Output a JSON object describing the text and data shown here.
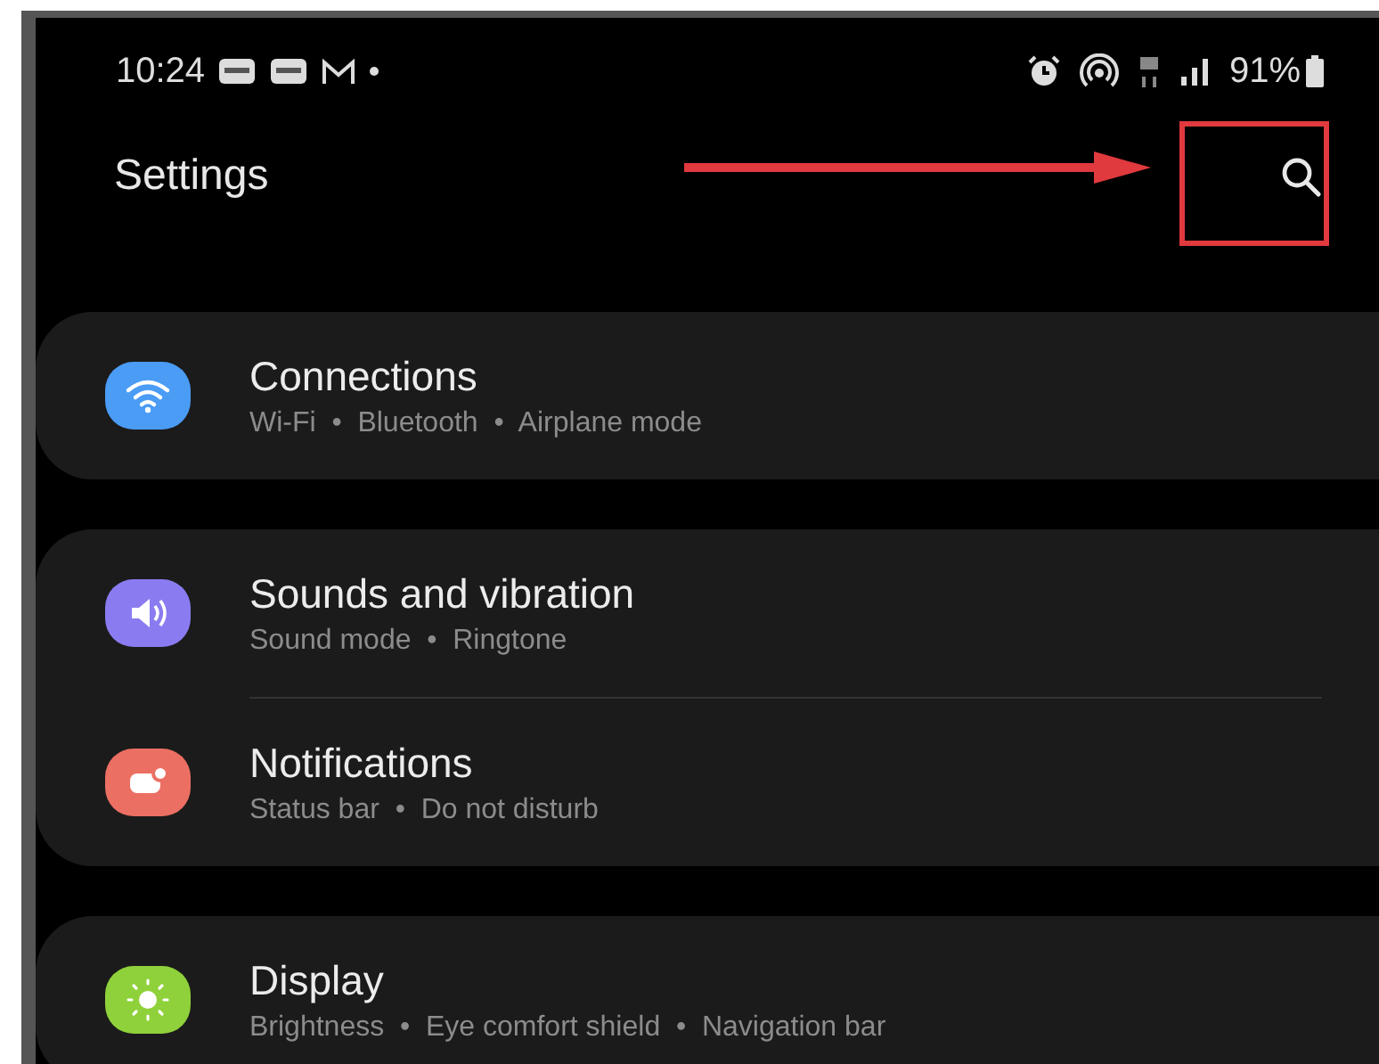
{
  "status_bar": {
    "time": "10:24",
    "battery": "91%"
  },
  "header": {
    "title": "Settings"
  },
  "groups": [
    {
      "items": [
        {
          "kind": "wifi",
          "color": "#4a9cf5",
          "title": "Connections",
          "subtitle": "Wi-Fi  •  Bluetooth  •  Airplane mode"
        }
      ]
    },
    {
      "items": [
        {
          "kind": "sound",
          "color": "#8a7cf0",
          "title": "Sounds and vibration",
          "subtitle": "Sound mode  •  Ringtone"
        },
        {
          "kind": "notification",
          "color": "#ec6f63",
          "title": "Notifications",
          "subtitle": "Status bar  •  Do not disturb"
        }
      ]
    },
    {
      "items": [
        {
          "kind": "display",
          "color": "#8fd13a",
          "title": "Display",
          "subtitle": "Brightness  •  Eye comfort shield  •  Navigation bar"
        }
      ]
    }
  ]
}
